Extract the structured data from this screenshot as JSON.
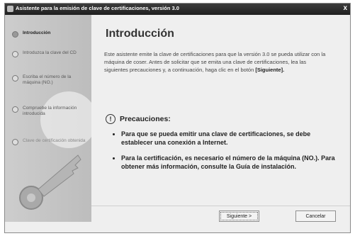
{
  "window": {
    "title": "Asistente para la emisión de clave de certificaciones, versión 3.0",
    "close_glyph": "x"
  },
  "sidebar": {
    "items": [
      {
        "label": "Introducción",
        "state": "active"
      },
      {
        "label": "Introduzca la clave del CD",
        "state": "normal"
      },
      {
        "label": "Escriba el número de la máquina (NO.)",
        "state": "normal"
      },
      {
        "label": "Compruebe la información introducida",
        "state": "normal"
      },
      {
        "label": "Clave de certificación obtenida",
        "state": "dim"
      }
    ]
  },
  "main": {
    "heading": "Introducción",
    "intro_text": "Este asistente emite la clave de certificaciones para que la versión 3.0 se pueda utilizar con la máquina de coser. Antes de solicitar que se emita una clave de certificaciones, lea las siguientes precauciones y, a continuación, haga clic en el botón",
    "intro_strong": "[Siguiente].",
    "caution_title": "Precauciones:",
    "caution_items": [
      "Para que se pueda emitir una clave de certificaciones, se debe establecer una conexión a Internet.",
      "Para la certificación, es necesario el número de la máquina (NO.). Para obtener más información, consulte la Guía de instalación."
    ]
  },
  "buttons": {
    "next": "Siguiente >",
    "cancel": "Cancelar"
  }
}
